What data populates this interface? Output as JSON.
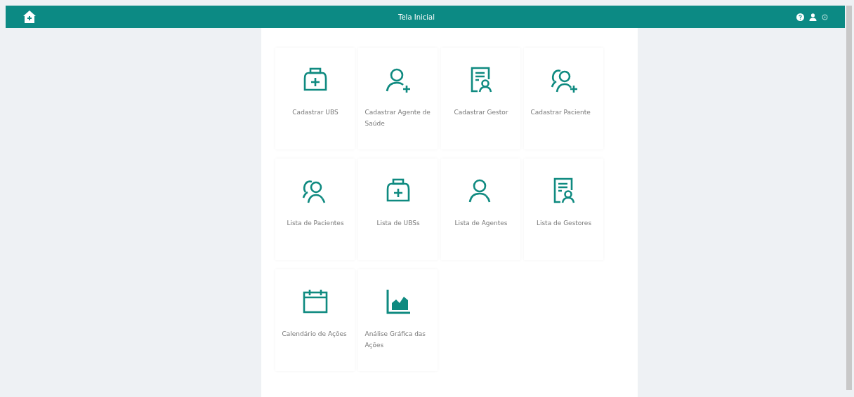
{
  "header": {
    "title": "Tela Inicial"
  },
  "tiles": [
    {
      "kind": "clinic-add",
      "label": "Cadastrar UBS"
    },
    {
      "kind": "user-add",
      "label": "Cadastrar Agente de Saúde"
    },
    {
      "kind": "document-user",
      "label": "Cadastrar Gestor"
    },
    {
      "kind": "users-add",
      "label": "Cadastrar Paciente"
    },
    {
      "kind": "users",
      "label": "Lista de Pacientes"
    },
    {
      "kind": "clinic",
      "label": "Lista de UBSs"
    },
    {
      "kind": "user",
      "label": "Lista de Agentes"
    },
    {
      "kind": "document-user",
      "label": "Lista de Gestores"
    },
    {
      "kind": "calendar",
      "label": "Calendário de Ações"
    },
    {
      "kind": "chart",
      "label": "Análise Gráfica das Ações"
    }
  ]
}
